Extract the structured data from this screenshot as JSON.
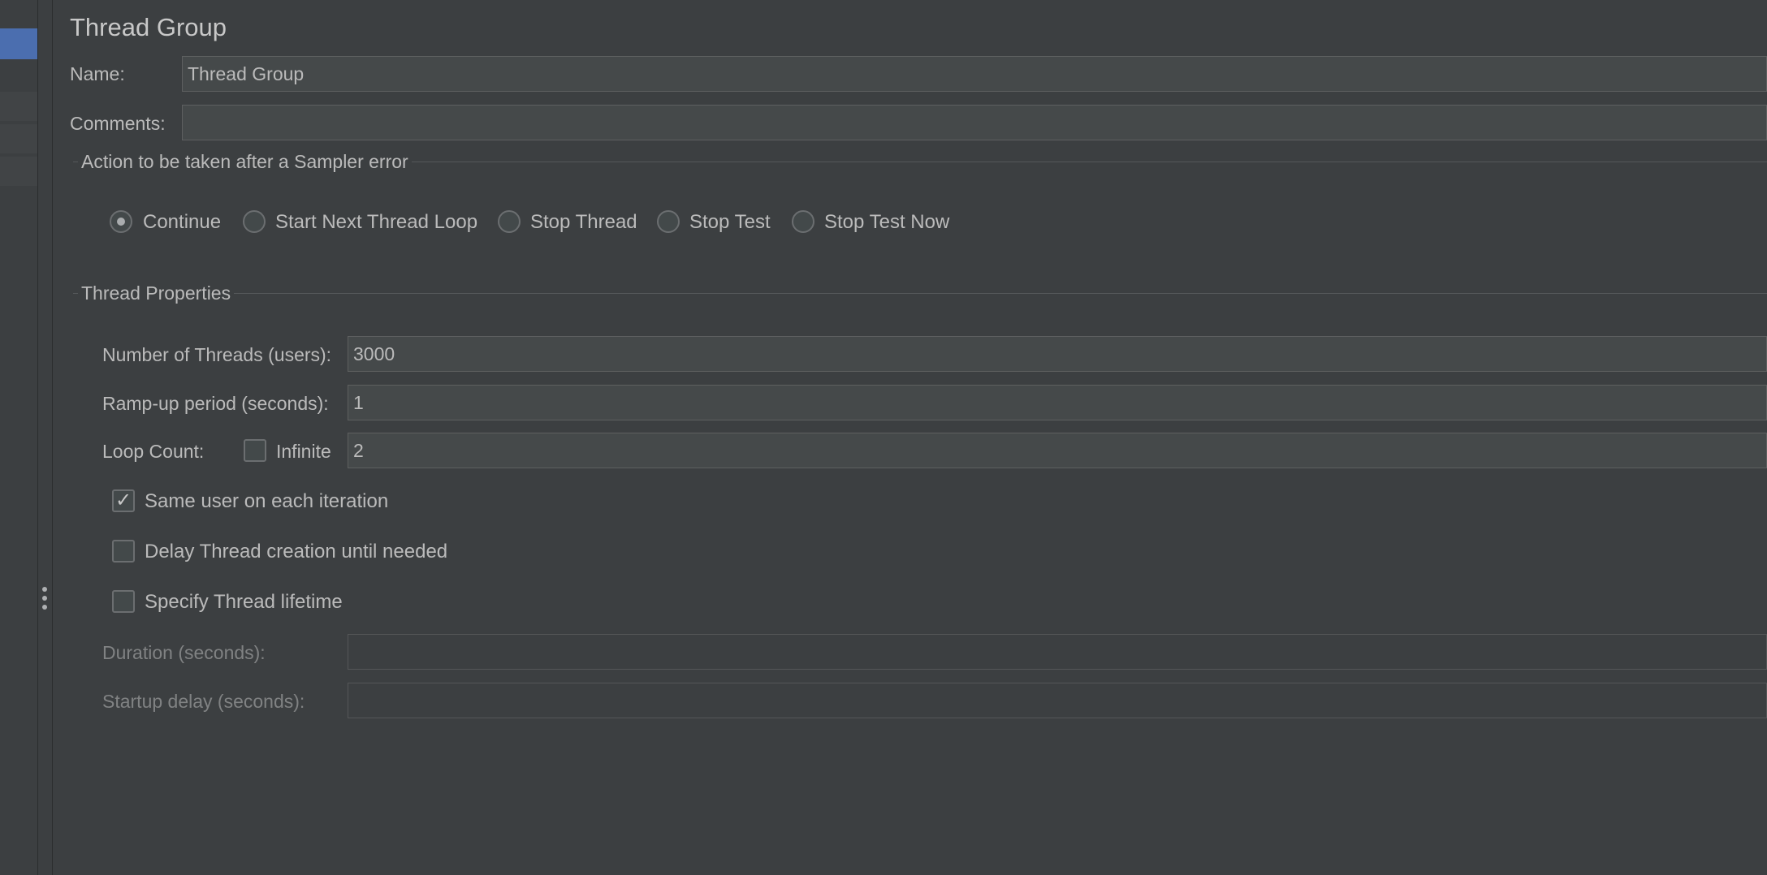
{
  "panel": {
    "title": "Thread Group"
  },
  "name_field": {
    "label": "Name:",
    "value": "Thread Group"
  },
  "comments_field": {
    "label": "Comments:",
    "value": ""
  },
  "sampler_error": {
    "title": "Action to be taken after a Sampler error",
    "options": [
      {
        "label": "Continue",
        "selected": true
      },
      {
        "label": "Start Next Thread Loop",
        "selected": false
      },
      {
        "label": "Stop Thread",
        "selected": false
      },
      {
        "label": "Stop Test",
        "selected": false
      },
      {
        "label": "Stop Test Now",
        "selected": false
      }
    ]
  },
  "thread_properties": {
    "title": "Thread Properties",
    "num_threads": {
      "label": "Number of Threads (users):",
      "value": "3000"
    },
    "ramp_up": {
      "label": "Ramp-up period (seconds):",
      "value": "1"
    },
    "loop_count": {
      "label": "Loop Count:",
      "infinite_label": "Infinite",
      "infinite_checked": false,
      "value": "2"
    },
    "same_user": {
      "label": "Same user on each iteration",
      "checked": true
    },
    "delay_creation": {
      "label": "Delay Thread creation until needed",
      "checked": false
    },
    "specify_lifetime": {
      "label": "Specify Thread lifetime",
      "checked": false
    },
    "duration": {
      "label": "Duration (seconds):",
      "value": ""
    },
    "startup_delay": {
      "label": "Startup delay (seconds):",
      "value": ""
    }
  },
  "icons": {
    "checkmark": "✓",
    "splitter": "vertical-ellipsis-icon"
  },
  "colors": {
    "background": "#3c3f41",
    "selection": "#4b6eaf",
    "field_bg": "#45494a",
    "text": "#bbbbbb"
  }
}
